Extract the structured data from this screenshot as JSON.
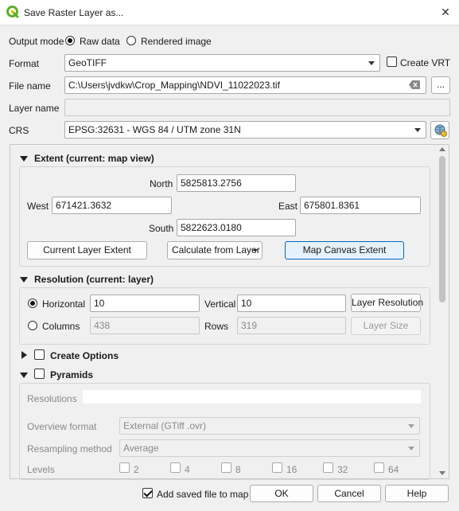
{
  "window": {
    "title": "Save Raster Layer as...",
    "close": "✕"
  },
  "output_mode": {
    "label": "Output mode",
    "raw": "Raw data",
    "rendered": "Rendered image"
  },
  "format": {
    "label": "Format",
    "value": "GeoTIFF",
    "create_vrt": "Create VRT"
  },
  "file_name": {
    "label": "File name",
    "value": "C:\\Users\\jvdkw\\Crop_Mapping\\NDVI_11022023.tif",
    "browse": "..."
  },
  "layer_name": {
    "label": "Layer name",
    "value": ""
  },
  "crs": {
    "label": "CRS",
    "value": "EPSG:32631 - WGS 84 / UTM zone 31N"
  },
  "extent": {
    "title": "Extent (current: map view)",
    "north_label": "North",
    "north": "5825813.2756",
    "west_label": "West",
    "west": "671421.3632",
    "east_label": "East",
    "east": "675801.8361",
    "south_label": "South",
    "south": "5822623.0180",
    "btn_current_layer": "Current Layer Extent",
    "btn_calculate": "Calculate from Layer",
    "btn_map_canvas": "Map Canvas Extent"
  },
  "resolution": {
    "title": "Resolution (current: layer)",
    "horizontal_label": "Horizontal",
    "horizontal": "10",
    "vertical_label": "Vertical",
    "vertical": "10",
    "btn_layer_resolution": "Layer Resolution",
    "columns_label": "Columns",
    "columns": "438",
    "rows_label": "Rows",
    "rows": "319",
    "btn_layer_size": "Layer Size"
  },
  "create_options": {
    "title": "Create Options"
  },
  "pyramids": {
    "title": "Pyramids",
    "resolutions_label": "Resolutions",
    "overview_label": "Overview format",
    "overview_value": "External (GTiff .ovr)",
    "resampling_label": "Resampling method",
    "resampling_value": "Average",
    "levels_label": "Levels",
    "levels": [
      "2",
      "4",
      "8",
      "16",
      "32",
      "64"
    ]
  },
  "footer": {
    "add_to_map": "Add saved file to map",
    "ok": "OK",
    "cancel": "Cancel",
    "help": "Help"
  },
  "colors": {
    "accent": "#0067c0",
    "logo_green": "#5db02c"
  }
}
